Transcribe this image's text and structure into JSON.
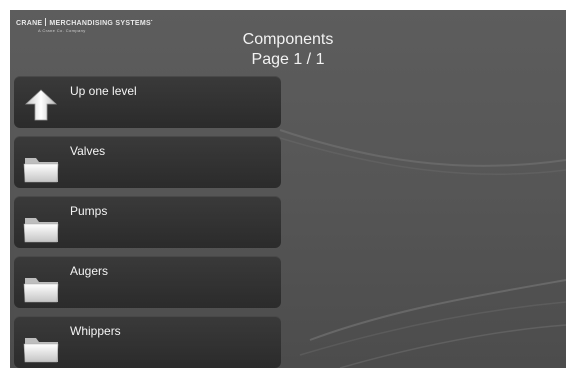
{
  "brand": {
    "name_left": "CRANE",
    "name_right": "MERCHANDISING SYSTEMS",
    "tagline": "A Crane Co. Company"
  },
  "header": {
    "title": "Components",
    "page": "Page 1 / 1"
  },
  "items": [
    {
      "label": "Up one level",
      "icon": "up-arrow-icon"
    },
    {
      "label": "Valves",
      "icon": "folder-icon"
    },
    {
      "label": "Pumps",
      "icon": "folder-icon"
    },
    {
      "label": "Augers",
      "icon": "folder-icon"
    },
    {
      "label": "Whippers",
      "icon": "folder-icon"
    }
  ],
  "colors": {
    "background": "#575757",
    "button": "#333333",
    "text": "#f2f2f2"
  }
}
